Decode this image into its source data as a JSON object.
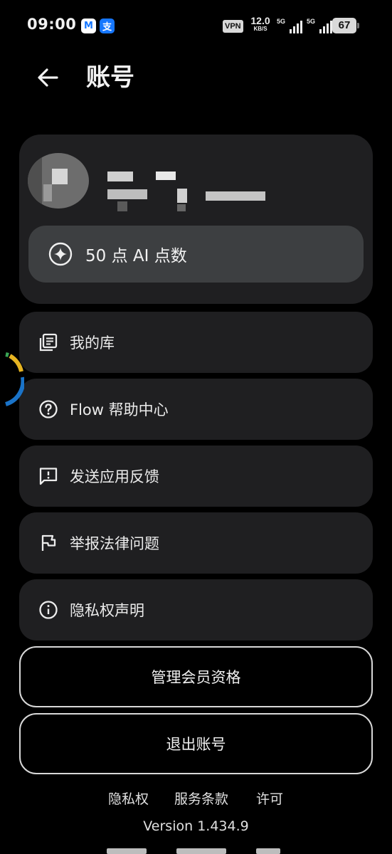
{
  "status_bar": {
    "time": "09:00",
    "app_badges": [
      {
        "name": "mail",
        "glyph": "M",
        "color": "#1677ff"
      },
      {
        "name": "alipay",
        "glyph": "支",
        "color": "#ffffff"
      }
    ],
    "vpn": "VPN",
    "speed_value": "12.0",
    "speed_unit": "KB/S",
    "signal_1": "5G",
    "signal_2": "5G",
    "battery": "67"
  },
  "header": {
    "title": "账号",
    "back_icon": "arrow-left-icon"
  },
  "account": {
    "avatar": "pixelated-avatar",
    "ai_points_label": "50 点 AI 点数",
    "ai_points_icon": "sparkle-circle-icon"
  },
  "menu": [
    {
      "label": "我的库",
      "icon": "library-icon"
    },
    {
      "label": "Flow 帮助中心",
      "icon": "help-circle-icon"
    },
    {
      "label": "发送应用反馈",
      "icon": "feedback-icon"
    },
    {
      "label": "举报法律问题",
      "icon": "flag-icon"
    },
    {
      "label": "隐私权声明",
      "icon": "info-icon"
    }
  ],
  "buttons": {
    "manage_membership": "管理会员资格",
    "sign_out": "退出账号"
  },
  "footer": {
    "links": [
      "隐私权",
      "服务条款",
      "许可"
    ],
    "version": "Version 1.434.9"
  },
  "colors": {
    "background": "#000000",
    "card": "#1f1f21",
    "pill": "#3d3f41",
    "text": "#ececec"
  }
}
